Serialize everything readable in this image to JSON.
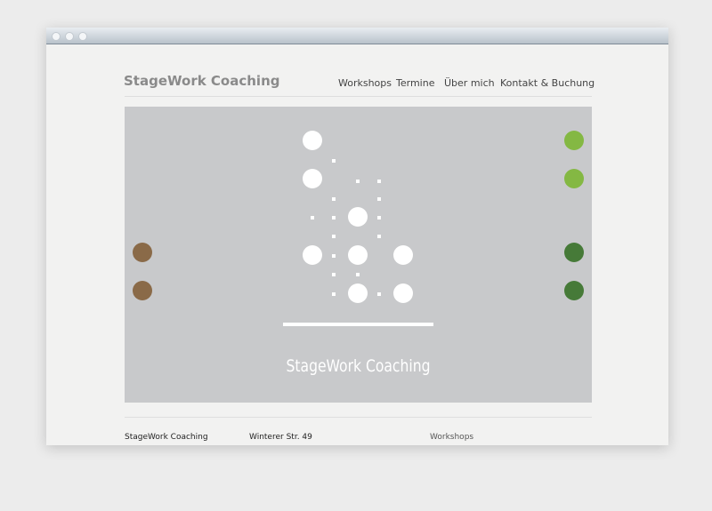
{
  "site": {
    "brand": "StageWork Coaching"
  },
  "nav": [
    {
      "label": "Workshops"
    },
    {
      "label": "Termine"
    },
    {
      "label": "Über mich"
    },
    {
      "label": "Kontakt & Buchung"
    }
  ],
  "hero": {
    "title": "StageWork Coaching",
    "colors": {
      "background": "#c8c9cb",
      "light_green": "#84b843",
      "dark_green": "#467a38",
      "brown": "#8a6a48",
      "white": "#ffffff"
    }
  },
  "footer": {
    "col1": "StageWork Coaching",
    "col2_line1": "Winterer Str. 49",
    "col3_line1": "Workshops"
  }
}
